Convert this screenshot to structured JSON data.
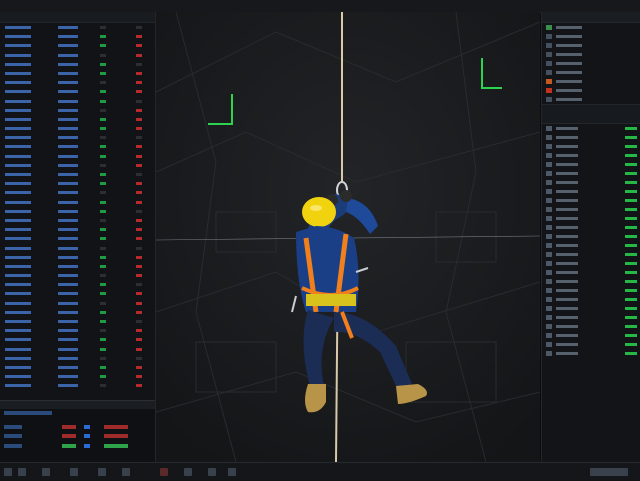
{
  "window": {
    "title": ""
  },
  "left_panel": {
    "rows": 40
  },
  "right_panel": {
    "top_items": 9,
    "list_items": 26
  },
  "scene": {
    "subject": "",
    "rope": true
  }
}
